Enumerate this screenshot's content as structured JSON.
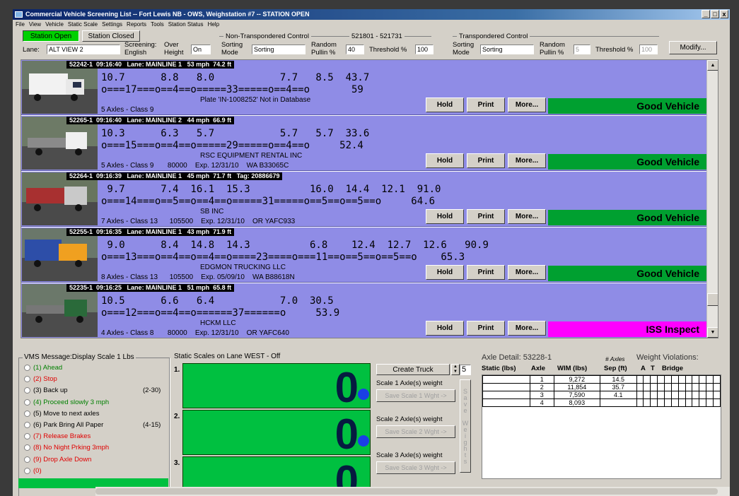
{
  "window": {
    "title": "Commercial Vehicle Screening List -- Fort Lewis NB - OWS, Weighstation #7 -- STATION OPEN",
    "controls": [
      "_",
      "□",
      "x"
    ]
  },
  "menu": [
    "File",
    "View",
    "Vehicle",
    "Static Scale",
    "Settings",
    "Reports",
    "Tools",
    "Station Status",
    "Help"
  ],
  "controls": {
    "station_open": "Station Open",
    "station_closed": "Station Closed",
    "lane_label": "Lane:",
    "lane_value": "ALT VIEW 2",
    "screening_label": "Screening:",
    "screening_value": "English",
    "over_height_label1": "Over",
    "over_height_label2": "Height",
    "over_height_value": "On",
    "nontrans_group": "Non-Transpondered Control",
    "nontrans_range": "521801 - 521731",
    "sorting_mode_label1": "Sorting",
    "sorting_mode_label2": "Mode",
    "sorting_mode_value": "Sorting",
    "random_pullin_label1": "Random",
    "random_pullin_label2": "Pullin %",
    "random_pullin_value": "40",
    "threshold_label": "Threshold %",
    "threshold_value": "100",
    "trans_group": "Transpondered Control",
    "t_sorting_mode_value": "Sorting",
    "t_random_pullin_value": "5",
    "t_threshold_value": "100",
    "modify": "Modify..."
  },
  "vehicles": [
    {
      "header": "52242-1  09:16:40   Lane: MAINLINE 1   53 mph  74.2 ft",
      "weights": "10.7      8.8   8.0           7.7   8.5  43.7",
      "axles": "o===17===o==4==o=====33=====o==4==o       59",
      "owner": "Plate 'IN-1008252' Not in Database",
      "class": "5 Axles - Class 9",
      "hold": "Hold",
      "print": "Print",
      "more": "More...",
      "status": "Good Vehicle",
      "status_color": "#00a030"
    },
    {
      "header": "52265-1  09:16:40   Lane: MAINLINE 2   44 mph  66.9 ft",
      "weights": "10.3      6.3   5.7           5.7   5.7  33.6",
      "axles": "o===15===o==4==o=====29=====o==4==o     52.4",
      "owner": "RSC EQUIPMENT RENTAL INC",
      "class": "5 Axles - Class 9       80000    Exp. 12/31/10    WA B33065C",
      "hold": "Hold",
      "print": "Print",
      "more": "More...",
      "status": "Good Vehicle",
      "status_color": "#00a030"
    },
    {
      "header": "52264-1  09:16:39   Lane: MAINLINE 1   45 mph  71.7 ft   Tag: 20886679",
      "weights": " 9.7      7.4  16.1  15.3          16.0  14.4  12.1  91.0",
      "axles": "o===14===o==5==o==4==o=====31=====o==5==o==5==o     64.6",
      "owner": "SB INC",
      "class": "7 Axles - Class 13      105500    Exp. 12/31/10    OR YAFC933",
      "hold": "Hold",
      "print": "Print",
      "more": "More...",
      "status": "Good Vehicle",
      "status_color": "#00a030"
    },
    {
      "header": "52255-1  09:16:35   Lane: MAINLINE 1   43 mph  71.9 ft",
      "weights": " 9.0      8.4  14.8  14.3          6.8    12.4  12.7  12.6   90.9",
      "axles": "o===13===o==4==o==4==o====23====o===11==o==5==o==5==o    65.3",
      "owner": "EDGMON TRUCKING LLC",
      "class": "8 Axles - Class 13      105500    Exp. 05/09/10    WA B88618N",
      "hold": "Hold",
      "print": "Print",
      "more": "More...",
      "status": "Good Vehicle",
      "status_color": "#00a030"
    },
    {
      "header": "52235-1  09:16:25   Lane: MAINLINE 1   51 mph  65.8 ft",
      "weights": "10.5      6.6   6.4           7.0  30.5",
      "axles": "o===12===o==4==o======37======o     53.9",
      "owner": "HCKM LLC",
      "class": "4 Axles - Class 8       80000    Exp. 12/31/10    OR YAFC640",
      "hold": "Hold",
      "print": "Print",
      "more": "More...",
      "status": "ISS Inspect",
      "status_color": "#ff00ff"
    }
  ],
  "vms": {
    "title": "VMS Message:Display Scale 1 Lbs",
    "items": [
      {
        "label": "(1) Ahead",
        "extra": "",
        "color": "#008000"
      },
      {
        "label": "(2) Stop",
        "extra": "",
        "color": "#e00000"
      },
      {
        "label": "(3) Back up",
        "extra": "(2-30)",
        "color": "#000000"
      },
      {
        "label": "(4) Proceed slowly 3 mph",
        "extra": "",
        "color": "#008000"
      },
      {
        "label": "(5) Move to next axles",
        "extra": "",
        "color": "#000000"
      },
      {
        "label": "(6) Park Bring All Paper",
        "extra": "(4-15)",
        "color": "#000000"
      },
      {
        "label": "(7) Release Brakes",
        "extra": "",
        "color": "#e00000"
      },
      {
        "label": "(8) No Night Prking 3mph",
        "extra": "",
        "color": "#e00000"
      },
      {
        "label": "(9) Drop Axle Down",
        "extra": "",
        "color": "#e00000"
      },
      {
        "label": "(0)",
        "extra": "",
        "color": "#e00000"
      }
    ]
  },
  "static": {
    "title": "Static Scales on Lane WEST - Off",
    "scales": [
      {
        "num": "1.",
        "value": "0"
      },
      {
        "num": "2.",
        "value": "0"
      },
      {
        "num": "3.",
        "value": "0"
      }
    ]
  },
  "truck": {
    "create": "Create Truck",
    "count": "5",
    "s1_label": "Scale 1 Axle(s) weight",
    "s1_btn": "Save Scale 1 Wght ->",
    "s2_label": "Scale 2 Axle(s) weight",
    "s2_btn": "Save Scale 2 Wght ->",
    "s3_label": "Scale 3 Axle(s) weight",
    "s3_btn": "Save Scale 3 Wght ->",
    "save_weights": "Save Weights"
  },
  "axle_detail": {
    "title": "Axle Detail:  53228-1",
    "axles_label": "# Axles",
    "violations": "Weight Violations:",
    "headers": [
      "Static (lbs)",
      "Axle",
      "WIM (lbs)",
      "Sep (ft)",
      "A",
      "T",
      "Bridge"
    ],
    "rows": [
      [
        "",
        "1",
        "9,272",
        "14.5"
      ],
      [
        "",
        "2",
        "11,854",
        "35.7"
      ],
      [
        "",
        "3",
        "7,590",
        "4.1"
      ],
      [
        "",
        "4",
        "8,093",
        ""
      ]
    ]
  }
}
